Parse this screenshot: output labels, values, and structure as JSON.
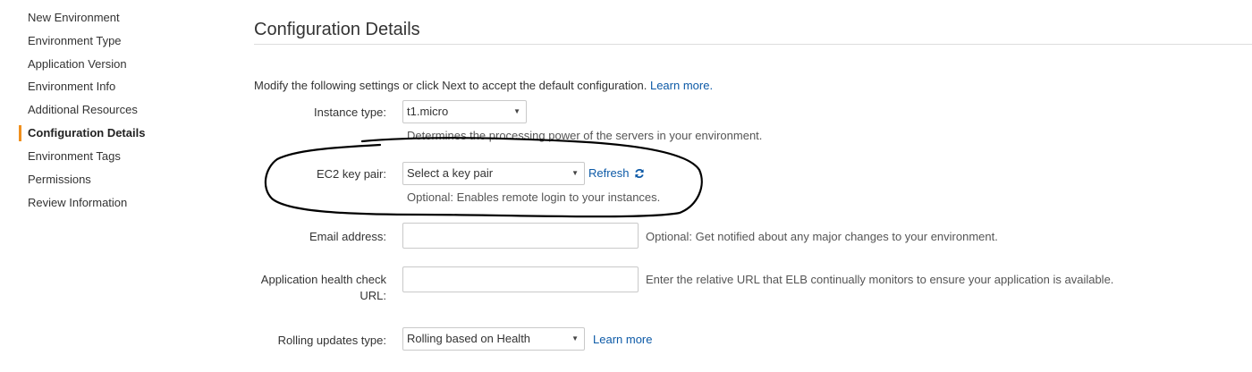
{
  "sidebar": {
    "items": [
      {
        "label": "New Environment"
      },
      {
        "label": "Environment Type"
      },
      {
        "label": "Application Version"
      },
      {
        "label": "Environment Info"
      },
      {
        "label": "Additional Resources"
      },
      {
        "label": "Configuration Details",
        "active": true
      },
      {
        "label": "Environment Tags"
      },
      {
        "label": "Permissions"
      },
      {
        "label": "Review Information"
      }
    ],
    "active_color": "#f0901e"
  },
  "main": {
    "title": "Configuration Details",
    "intro": "Modify the following settings or click Next to accept the default configuration.",
    "intro_link": "Learn more.",
    "instance_type": {
      "label": "Instance type:",
      "value": "t1.micro",
      "help": "Determines the processing power of the servers in your environment."
    },
    "key_pair": {
      "label": "EC2 key pair:",
      "value": "Select a key pair",
      "refresh_label": "Refresh",
      "refresh_icon": "refresh-icon",
      "help": "Optional: Enables remote login to your instances."
    },
    "email": {
      "label": "Email address:",
      "value": "",
      "help": "Optional: Get notified about any major changes to your environment."
    },
    "health_check": {
      "label_line1": "Application health check",
      "label_line2": "URL:",
      "value": "",
      "help": "Enter the relative URL that ELB continually monitors to ensure your application is available."
    },
    "rolling_updates": {
      "label": "Rolling updates type:",
      "value": "Rolling based on Health",
      "link": "Learn more"
    }
  },
  "colors": {
    "link": "#0d5aa7",
    "text": "#333333",
    "help_text": "#555555",
    "border": "#c9c9c9",
    "annotation": "#000000"
  }
}
